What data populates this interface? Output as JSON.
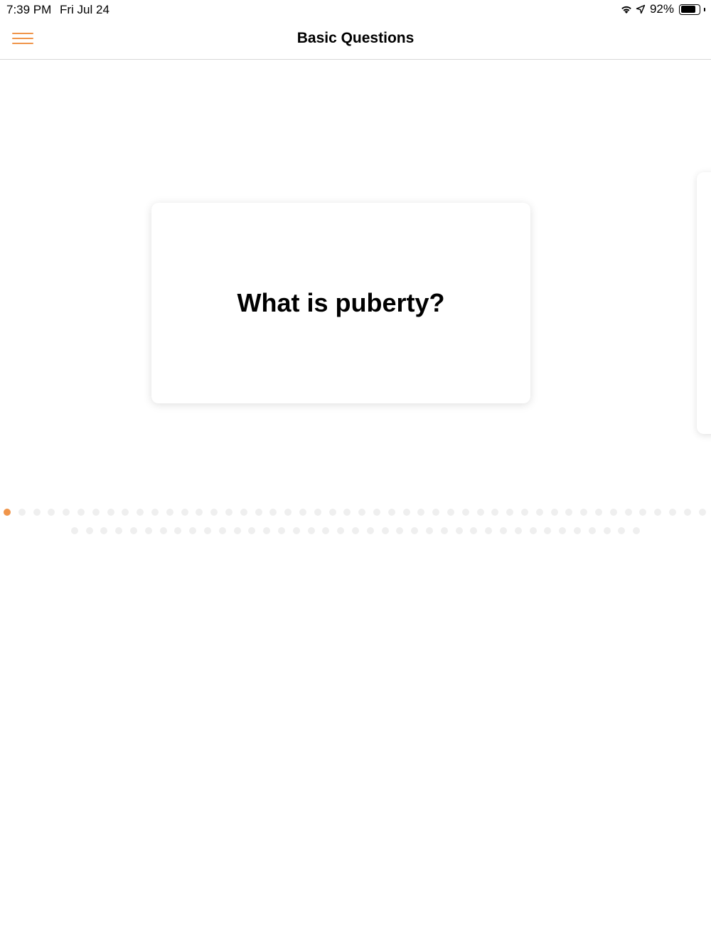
{
  "status_bar": {
    "time": "7:39 PM",
    "date": "Fri Jul 24",
    "battery_percent": "92%",
    "battery_level": 0.92,
    "icons": [
      "wifi-icon",
      "location-arrow-icon",
      "battery-icon"
    ]
  },
  "nav": {
    "title": "Basic Questions",
    "menu_icon": "hamburger-menu-icon"
  },
  "card": {
    "question": "What is puberty?"
  },
  "pagination": {
    "total": 87,
    "current_index": 0
  },
  "colors": {
    "accent": "#f0954a",
    "dot_inactive": "#efefef",
    "divider": "#d8d8d8"
  }
}
